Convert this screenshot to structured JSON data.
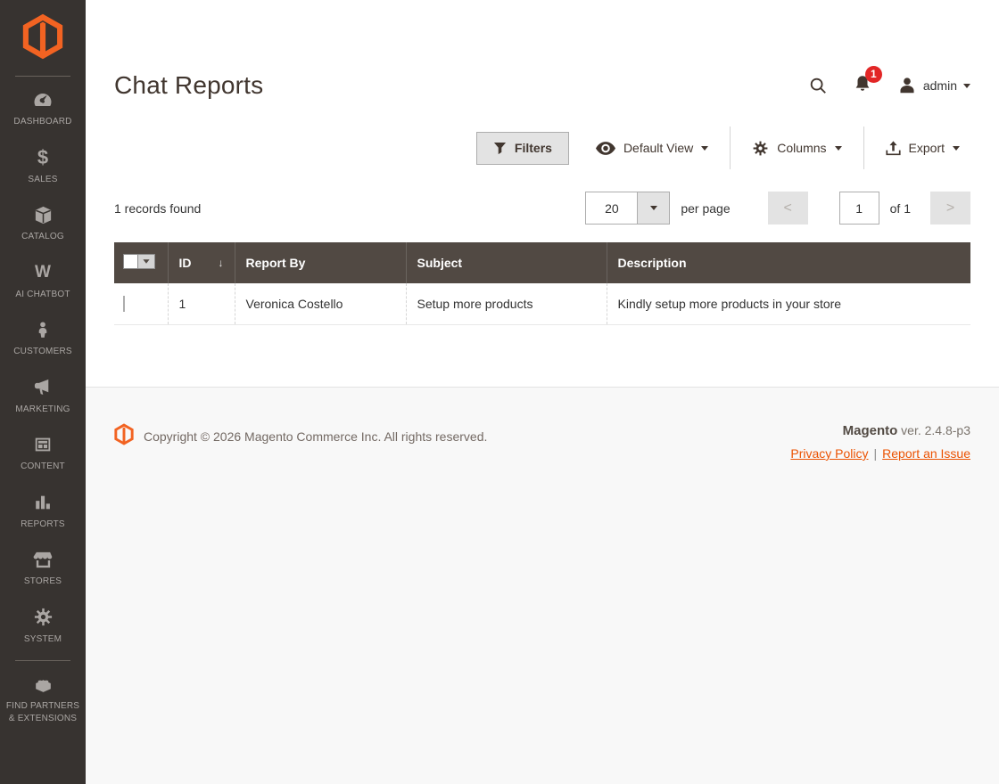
{
  "colors": {
    "accent_orange": "#f26322",
    "badge_red": "#e22626",
    "sidebar_bg": "#373330",
    "grid_header_bg": "#514943",
    "footer_link": "#eb5202",
    "button_gray": "#e3e3e3"
  },
  "sidebar": {
    "items": [
      {
        "icon": "dashboard-icon",
        "label": "DASHBOARD"
      },
      {
        "icon": "sales-icon",
        "label": "SALES"
      },
      {
        "icon": "catalog-icon",
        "label": "CATALOG"
      },
      {
        "icon": "ai-chatbot-icon",
        "label": "AI CHATBOT"
      },
      {
        "icon": "customers-icon",
        "label": "CUSTOMERS"
      },
      {
        "icon": "marketing-icon",
        "label": "MARKETING"
      },
      {
        "icon": "content-icon",
        "label": "CONTENT"
      },
      {
        "icon": "reports-icon",
        "label": "REPORTS"
      },
      {
        "icon": "stores-icon",
        "label": "STORES"
      },
      {
        "icon": "system-icon",
        "label": "SYSTEM"
      },
      {
        "icon": "find-partners-icon",
        "label": "FIND PARTNERS & EXTENSIONS"
      }
    ]
  },
  "header": {
    "page_title": "Chat Reports",
    "notifications": {
      "count": "1"
    },
    "user": {
      "name": "admin"
    }
  },
  "toolbar": {
    "filters_label": "Filters",
    "default_view_label": "Default View",
    "columns_label": "Columns",
    "export_label": "Export"
  },
  "grid_controls": {
    "records_found": "1 records found",
    "per_page": {
      "value": "20",
      "suffix": "per page"
    },
    "pagination": {
      "current": "1",
      "of_label": "of 1"
    }
  },
  "icons": {
    "sort_desc": "↓",
    "page_prev": "<",
    "page_next": ">",
    "ai_chatbot_glyph": "W",
    "sales_glyph": "$"
  },
  "table": {
    "columns": [
      {
        "label": "ID",
        "sorted": "desc"
      },
      {
        "label": "Report By"
      },
      {
        "label": "Subject"
      },
      {
        "label": "Description"
      }
    ],
    "rows": [
      {
        "id": "1",
        "report_by": "Veronica Costello",
        "subject": "Setup more products",
        "description": "Kindly setup more products in your store",
        "checked": false
      }
    ]
  },
  "footer": {
    "copyright": "Copyright © 2026 Magento Commerce Inc. All rights reserved.",
    "brand": "Magento",
    "version": "ver. 2.4.8-p3",
    "separator": "|",
    "links": [
      {
        "label": "Privacy Policy"
      },
      {
        "label": "Report an Issue"
      }
    ]
  }
}
